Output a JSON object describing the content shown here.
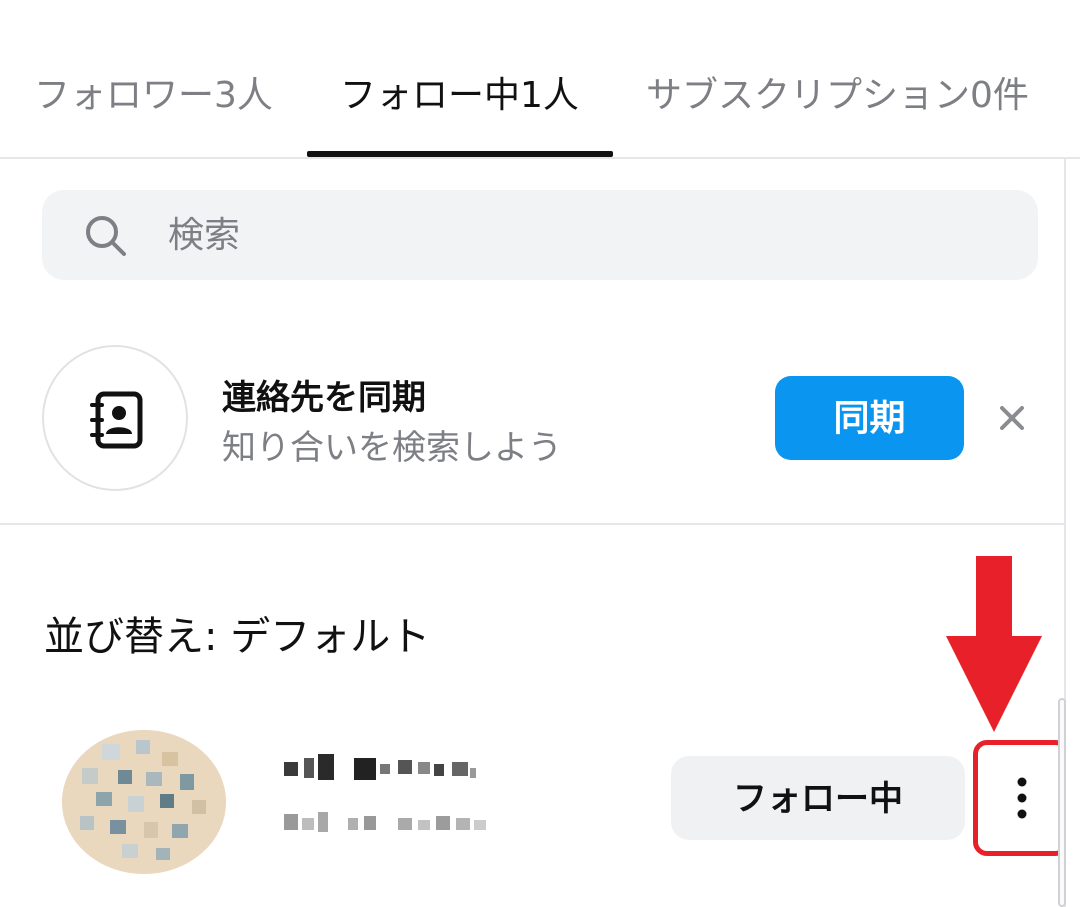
{
  "tabs": [
    {
      "label": "フォロワー3人",
      "active": false
    },
    {
      "label": "フォロー中1人",
      "active": true
    },
    {
      "label": "サブスクリプション0件",
      "active": false
    }
  ],
  "search": {
    "placeholder": "検索",
    "icon": "search-icon"
  },
  "contact_sync": {
    "title": "連絡先を同期",
    "subtitle": "知り合いを検索しよう",
    "button_label": "同期",
    "icon": "contact-book-icon",
    "dismiss_icon": "close-icon"
  },
  "sort": {
    "label": "並び替え: デフォルト"
  },
  "following_list": [
    {
      "name_obscured": true,
      "id_obscured": true,
      "following_button_label": "フォロー中",
      "more_icon": "more-vertical-icon"
    }
  ],
  "annotation": {
    "arrow_color": "#e8202a",
    "highlight_color": "#e8202a"
  },
  "colors": {
    "accent": "#0a95f0",
    "text_primary": "#111111",
    "text_secondary": "#7d7f84",
    "chip_bg": "#f0f1f3"
  }
}
